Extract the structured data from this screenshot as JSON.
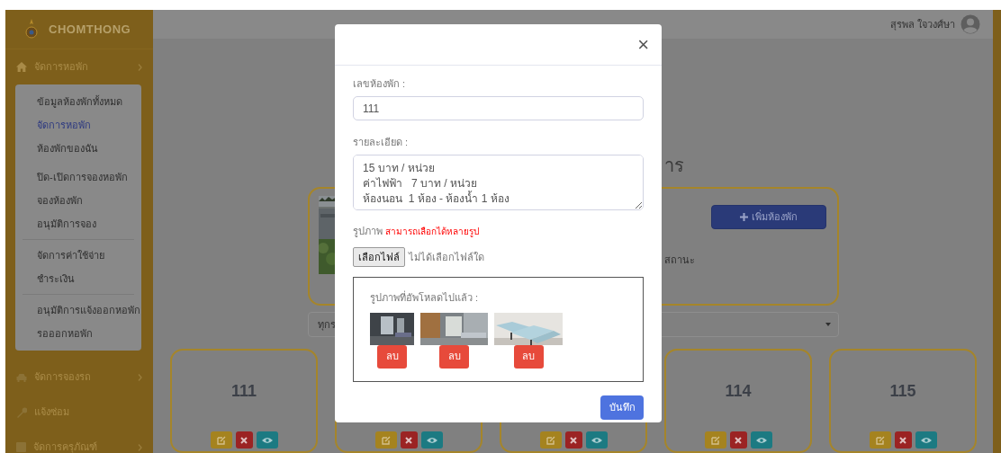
{
  "brand": {
    "name": "CHOMTHONG"
  },
  "sidebar": {
    "items": [
      {
        "label": "จัดการหอพัก",
        "has_submenu": true,
        "groups": [
          [
            {
              "label": "ข้อมูลห้องพักทั้งหมด",
              "selected": false
            },
            {
              "label": "จัดการหอพัก",
              "selected": true
            },
            {
              "label": "ห้องพักของฉัน",
              "selected": false
            },
            {
              "label": "ปิด-เปิดการจองหอพัก",
              "selected": false
            },
            {
              "label": "จองห้องพัก",
              "selected": false
            },
            {
              "label": "อนุมัติการจอง",
              "selected": false
            }
          ],
          [
            {
              "label": "จัดการค่าใช้จ่าย",
              "selected": false
            },
            {
              "label": "ชำระเงิน",
              "selected": false
            }
          ],
          [
            {
              "label": "อนุมัติการแจ้งออกหอพัก",
              "selected": false
            },
            {
              "label": "รอออกหอพัก",
              "selected": false
            }
          ]
        ]
      },
      {
        "label": "จัดการจองรถ",
        "has_submenu": true
      },
      {
        "label": "แจ้งซ่อม",
        "has_submenu": false
      },
      {
        "label": "จัดการครุภัณฑ์",
        "has_submenu": true
      }
    ]
  },
  "header": {
    "user_name": "สุรพล ใจวงศ์ษา"
  },
  "page": {
    "heading": "าร",
    "add_button": "เพิ่มห้องพัก",
    "status_label": "สถานะ",
    "filter_value": "ทุกร"
  },
  "rooms": [
    {
      "kind": "room",
      "number": "111"
    },
    {
      "kind": "covered"
    },
    {
      "kind": "covered"
    },
    {
      "kind": "room",
      "number": "114"
    },
    {
      "kind": "room",
      "number": "115"
    }
  ],
  "modal": {
    "close": "×",
    "room_label": "เลขห้องพัก :",
    "room_value": "111",
    "details_label": "รายละเอียด :",
    "details_lines": [
      "15 บาท / หน่วย",
      "ค่าไฟฟ้า   7 บาท / หน่วย",
      "ห้องนอน  1 ห้อง - ห้องน้ำ 1 ห้อง"
    ],
    "images_label": "รูปภาพ",
    "images_hint": "สามารถเลือกได้หลายรูป",
    "file_button": "เลือกไฟล์",
    "file_status": "ไม่ได้เลือกไฟล์ใด",
    "uploaded_title": "รูปภาพที่อัพโหลดไปแล้ว :",
    "uploaded": [
      {
        "delete": "ลบ"
      },
      {
        "delete": "ลบ"
      },
      {
        "delete": "ลบ"
      }
    ],
    "save": "บันทึก"
  }
}
